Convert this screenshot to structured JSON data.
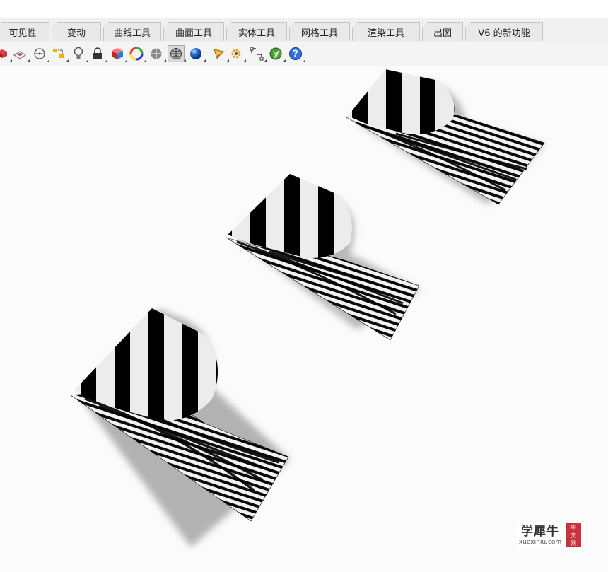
{
  "tabs": [
    {
      "label": "可见性"
    },
    {
      "label": "变动"
    },
    {
      "label": "曲线工具"
    },
    {
      "label": "曲面工具"
    },
    {
      "label": "实体工具"
    },
    {
      "label": "网格工具"
    },
    {
      "label": "渲染工具"
    },
    {
      "label": "出图"
    },
    {
      "label": "V6 的新功能"
    }
  ],
  "toolbar": {
    "icons": [
      "shaded-object-icon",
      "properties-icon",
      "circle-measure-icon",
      "dimension-icon",
      "light-bulb-icon",
      "lock-icon",
      "material-icon",
      "color-wheel-icon",
      "zebra-sphere-icon",
      "environment-sphere-icon",
      "render-sphere-icon",
      "pencil-icon",
      "gear-icon",
      "grid-snap-icon",
      "globe-icon",
      "help-icon"
    ]
  },
  "viewport": {
    "analysis_mode": "zebra-stripes",
    "objects": 3
  },
  "watermark": {
    "text_cn": "学犀牛",
    "text_en": "xuexiniu.com",
    "seal": [
      "中",
      "文",
      "网"
    ],
    "seal_color": "#c8323c"
  }
}
